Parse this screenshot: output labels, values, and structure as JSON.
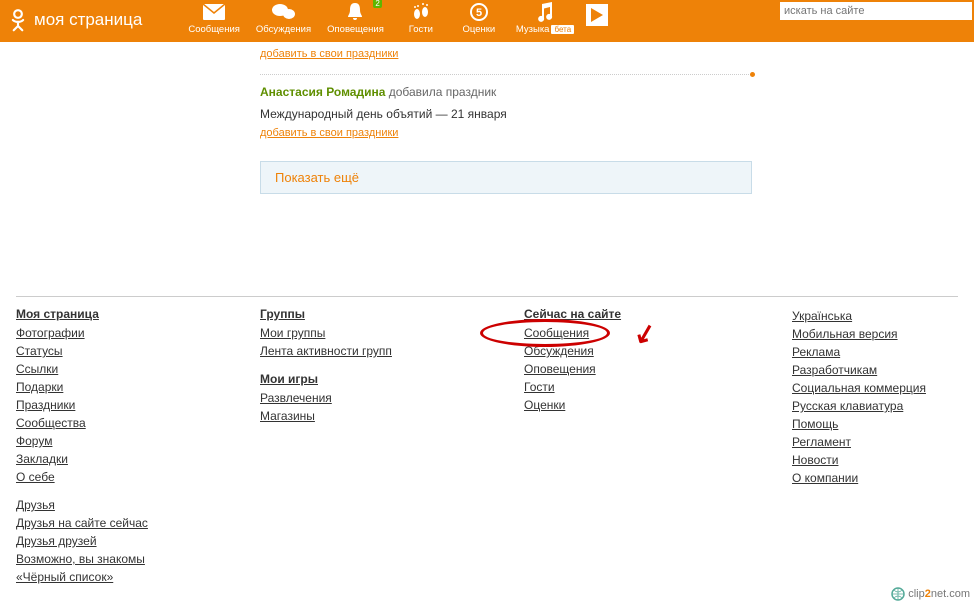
{
  "header": {
    "title": "моя страница",
    "nav": [
      {
        "label": "Сообщения",
        "icon": "envelope"
      },
      {
        "label": "Обсуждения",
        "icon": "chat",
        "badge": ""
      },
      {
        "label": "Оповещения",
        "icon": "bell",
        "badge": "2"
      },
      {
        "label": "Гости",
        "icon": "feet"
      },
      {
        "label": "Оценки",
        "icon": "rating"
      },
      {
        "label": "Музыка",
        "icon": "music",
        "beta": "бета"
      }
    ],
    "search_placeholder": "искать на сайте"
  },
  "feed": {
    "add_link_top": "добавить в свои праздники",
    "person": "Анастасия Ромадина",
    "action": " добавила праздник",
    "holiday": "Международный день объятий — 21 января",
    "add_link": "добавить в свои праздники",
    "show_more": "Показать ещё"
  },
  "footer": {
    "col1": {
      "head": "Моя страница",
      "links": [
        "Фотографии",
        "Статусы",
        "Ссылки",
        "Подарки",
        "Праздники",
        "Сообщества",
        "Форум",
        "Закладки",
        "О себе"
      ],
      "head2_spaced": true,
      "links2": [
        "Друзья",
        "Друзья на сайте сейчас",
        "Друзья друзей",
        "Возможно, вы знакомы",
        "«Чёрный список»"
      ]
    },
    "col2": {
      "g1_head": "Группы",
      "g1_links": [
        "Мои группы",
        "Лента активности групп"
      ],
      "g2_head": "Мои игры",
      "g2_links": [
        "Развлечения",
        "Магазины"
      ]
    },
    "col3": {
      "head": "Сейчас на сайте",
      "links": [
        "Сообщения",
        "Обсуждения",
        "Оповещения",
        "Гости",
        "Оценки"
      ]
    },
    "col4": {
      "links": [
        "Українська",
        "Мобильная версия",
        "Реклама",
        "Разработчикам",
        "Социальная коммерция",
        "Русская клавиатура",
        "Помощь",
        "Регламент",
        "Новости",
        "О компании"
      ]
    }
  },
  "watermark": {
    "brand": "clip",
    "two": "2",
    "net": "net",
    "dom": ".com"
  }
}
